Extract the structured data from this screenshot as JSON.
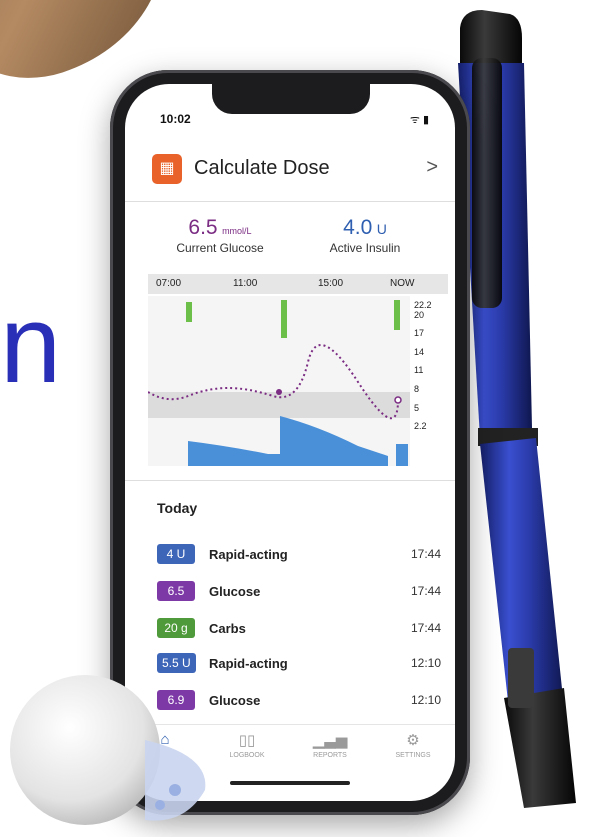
{
  "status_bar": {
    "time": "10:02",
    "icons": "ᯤ ▮"
  },
  "calculate": {
    "icon": "calculator-icon",
    "title": "Calculate Dose",
    "chevron": ">"
  },
  "metrics": {
    "glucose_value": "6.5",
    "glucose_unit": "mmol/L",
    "glucose_label": "Current Glucose",
    "insulin_value": "4.0",
    "insulin_unit": "U",
    "insulin_label": "Active Insulin"
  },
  "timeline": [
    "07:00",
    "11:00",
    "15:00",
    "NOW"
  ],
  "chart_data": {
    "type": "line",
    "y_ticks": [
      "22.2",
      "20",
      "17",
      "14",
      "11",
      "8",
      "5",
      "2.2"
    ],
    "target_band": [
      5,
      8
    ],
    "colors": {
      "glucose": "#7b2c83",
      "insulin": "#4a90d9",
      "bolus": "#6cc04a",
      "band": "#dcdcdc"
    }
  },
  "today": {
    "heading": "Today",
    "entries": [
      {
        "badge": "4 U",
        "color": "#3e66b8",
        "name": "Rapid-acting",
        "time": "17:44"
      },
      {
        "badge": "6.5",
        "color": "#7d3aa7",
        "name": "Glucose",
        "time": "17:44"
      },
      {
        "badge": "20 g",
        "color": "#4f9a3a",
        "name": "Carbs",
        "time": "17:44"
      },
      {
        "badge": "5.5 U",
        "color": "#3e66b8",
        "name": "Rapid-acting",
        "time": "12:10"
      },
      {
        "badge": "6.9",
        "color": "#7d3aa7",
        "name": "Glucose",
        "time": "12:10"
      }
    ]
  },
  "tabs": [
    {
      "icon": "home-icon",
      "label": ""
    },
    {
      "icon": "book-icon",
      "label": "LOGBOOK"
    },
    {
      "icon": "bar-chart-icon",
      "label": "REPORTS"
    },
    {
      "icon": "gear-icon",
      "label": "SETTINGS"
    }
  ],
  "background": {
    "big_letter": "n"
  }
}
